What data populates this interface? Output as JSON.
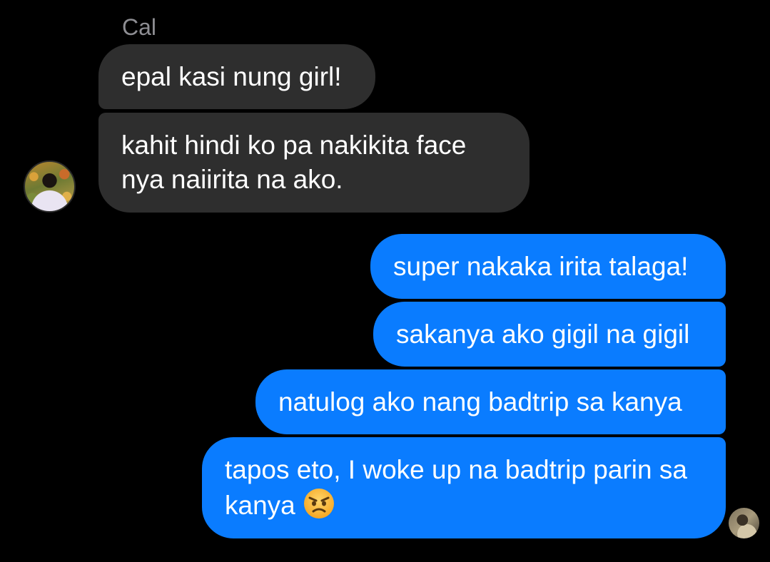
{
  "conversation": {
    "sender_name": "Cal",
    "incoming": [
      {
        "text": "epal kasi nung girl!"
      },
      {
        "text": "kahit hindi ko pa nakikita face nya naiirita na ako."
      }
    ],
    "outgoing": [
      {
        "text": "super nakaka irita talaga!"
      },
      {
        "text": "sakanya ako gigil na gigil"
      },
      {
        "text": "natulog ako nang badtrip sa kanya"
      },
      {
        "text": "tapos eto, I woke up na badtrip parin sa kanya",
        "emoji": "angry-face"
      }
    ]
  },
  "colors": {
    "background": "#000000",
    "incoming_bubble": "#2e2e2e",
    "outgoing_bubble": "#0a7cff",
    "sender_name": "#8e8e93",
    "text": "#ffffff"
  },
  "icons": {
    "contact_avatar": "avatar-photo",
    "read_receipt_avatar": "avatar-photo",
    "emoji": "angry-face"
  }
}
